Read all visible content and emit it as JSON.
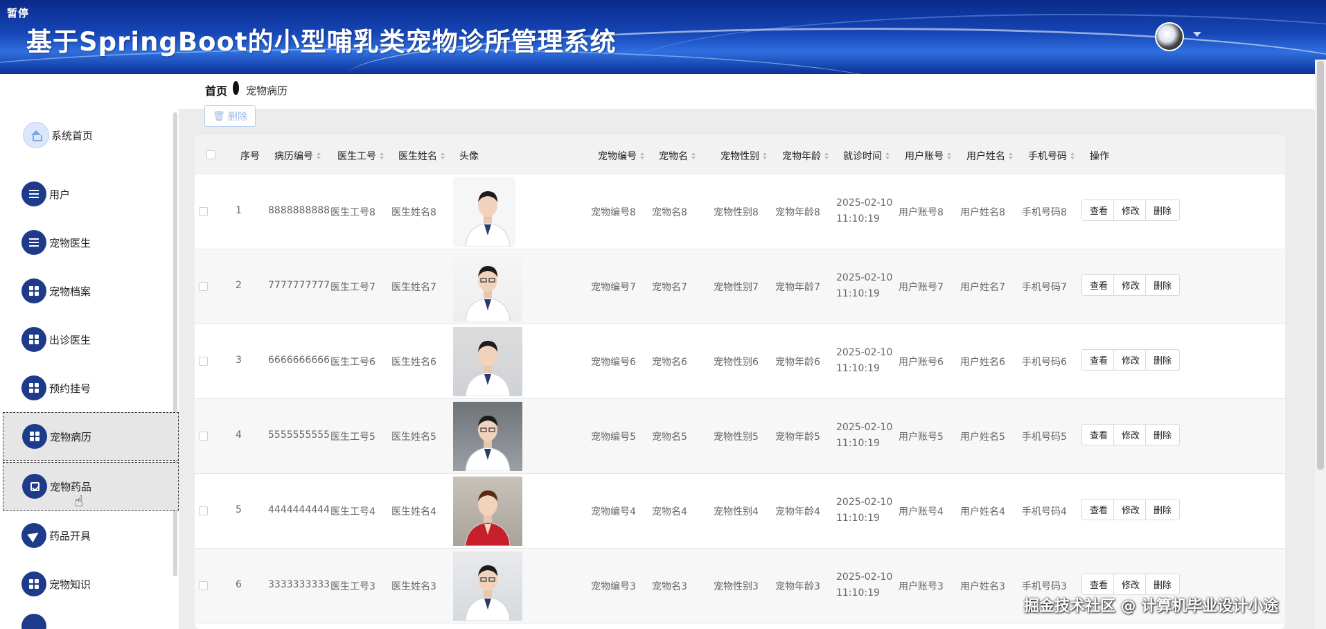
{
  "header": {
    "pause_tag": "暂停",
    "title": "基于SpringBoot的小型哺乳类宠物诊所管理系统"
  },
  "sidebar": {
    "items": [
      {
        "label": "系统首页",
        "icon": "home-icon"
      },
      {
        "label": "用户",
        "icon": "list-icon"
      },
      {
        "label": "宠物医生",
        "icon": "sliders-icon"
      },
      {
        "label": "宠物档案",
        "icon": "grid-icon"
      },
      {
        "label": "出诊医生",
        "icon": "grid-icon"
      },
      {
        "label": "预约挂号",
        "icon": "grid-icon"
      },
      {
        "label": "宠物病历",
        "icon": "grid-icon",
        "active": true
      },
      {
        "label": "宠物药品",
        "icon": "chart-icon",
        "hover": true
      },
      {
        "label": "药品开具",
        "icon": "send-icon"
      },
      {
        "label": "宠物知识",
        "icon": "grid-icon"
      }
    ]
  },
  "breadcrumb": {
    "home": "首页",
    "current": "宠物病历"
  },
  "toolbar": {
    "delete_label": "删除"
  },
  "table": {
    "headers": {
      "index": "序号",
      "record_no": "病历编号",
      "doctor_id": "医生工号",
      "doctor_name": "医生姓名",
      "avatar": "头像",
      "pet_no": "宠物编号",
      "pet_name": "宠物名",
      "pet_gender": "宠物性别",
      "pet_age": "宠物年龄",
      "visit_time": "就诊时间",
      "user_account": "用户账号",
      "user_name": "用户姓名",
      "phone": "手机号码",
      "ops": "操作"
    },
    "actions": {
      "view": "查看",
      "edit": "修改",
      "delete": "删除"
    },
    "rows": [
      {
        "index": "1",
        "record_no": "8888888888",
        "doctor_id": "医生工号8",
        "doctor_name": "医生姓名8",
        "pet_no": "宠物编号8",
        "pet_name": "宠物名8",
        "pet_gender": "宠物性别8",
        "pet_age": "宠物年龄8",
        "visit_date": "2025-02-10",
        "visit_clock": "11:10:19",
        "user_account": "用户账号8",
        "user_name": "用户姓名8",
        "phone": "手机号码8"
      },
      {
        "index": "2",
        "record_no": "7777777777",
        "doctor_id": "医生工号7",
        "doctor_name": "医生姓名7",
        "pet_no": "宠物编号7",
        "pet_name": "宠物名7",
        "pet_gender": "宠物性别7",
        "pet_age": "宠物年龄7",
        "visit_date": "2025-02-10",
        "visit_clock": "11:10:19",
        "user_account": "用户账号7",
        "user_name": "用户姓名7",
        "phone": "手机号码7"
      },
      {
        "index": "3",
        "record_no": "6666666666",
        "doctor_id": "医生工号6",
        "doctor_name": "医生姓名6",
        "pet_no": "宠物编号6",
        "pet_name": "宠物名6",
        "pet_gender": "宠物性别6",
        "pet_age": "宠物年龄6",
        "visit_date": "2025-02-10",
        "visit_clock": "11:10:19",
        "user_account": "用户账号6",
        "user_name": "用户姓名6",
        "phone": "手机号码6"
      },
      {
        "index": "4",
        "record_no": "5555555555",
        "doctor_id": "医生工号5",
        "doctor_name": "医生姓名5",
        "pet_no": "宠物编号5",
        "pet_name": "宠物名5",
        "pet_gender": "宠物性别5",
        "pet_age": "宠物年龄5",
        "visit_date": "2025-02-10",
        "visit_clock": "11:10:19",
        "user_account": "用户账号5",
        "user_name": "用户姓名5",
        "phone": "手机号码5"
      },
      {
        "index": "5",
        "record_no": "4444444444",
        "doctor_id": "医生工号4",
        "doctor_name": "医生姓名4",
        "pet_no": "宠物编号4",
        "pet_name": "宠物名4",
        "pet_gender": "宠物性别4",
        "pet_age": "宠物年龄4",
        "visit_date": "2025-02-10",
        "visit_clock": "11:10:19",
        "user_account": "用户账号4",
        "user_name": "用户姓名4",
        "phone": "手机号码4"
      },
      {
        "index": "6",
        "record_no": "3333333333",
        "doctor_id": "医生工号3",
        "doctor_name": "医生姓名3",
        "pet_no": "宠物编号3",
        "pet_name": "宠物名3",
        "pet_gender": "宠物性别3",
        "pet_age": "宠物年龄3",
        "visit_date": "2025-02-10",
        "visit_clock": "11:10:19",
        "user_account": "用户账号3",
        "user_name": "用户姓名3",
        "phone": "手机号码3"
      }
    ]
  },
  "watermark": "掘金技术社区 @ 计算机毕业设计小途",
  "colors": {
    "header_blue": "#1646b6",
    "sidebar_icon_bg": "#1e3b8b",
    "active_item_bg": "#e6e6e6",
    "delete_btn_border": "#b6cdf0"
  }
}
